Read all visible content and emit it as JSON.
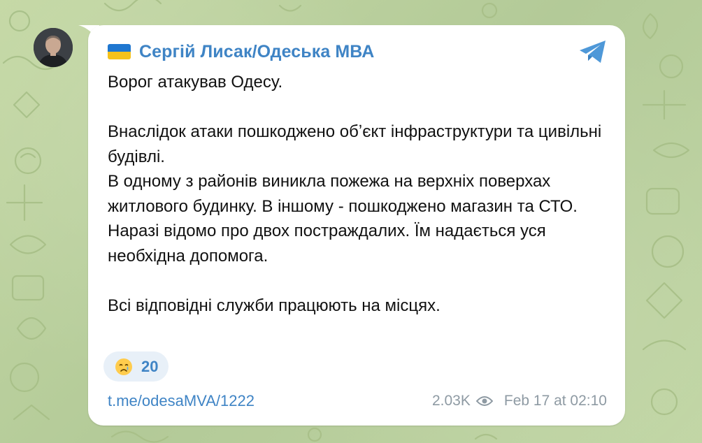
{
  "channel": {
    "name": "Сергій Лисак/Одеська МВА",
    "flag_icon": "ukraine-flag-icon",
    "brand_color": "#3f84c5"
  },
  "message": {
    "text": "Ворог атакував Одесу.\n\nВнаслідок атаки пошкоджено обʼєкт інфраструктури та цивільні будівлі.\nВ одному з районів виникла пожежа на верхніх поверхах житлового будинку. В іншому - пошкоджено магазин та СТО.\nНаразі відомо про двох постраждалих. Їм надається уся необхідна допомога.\n\nВсі відповідні служби працюють на місцях."
  },
  "reaction": {
    "emoji_icon": "crying-face-icon",
    "count": "20"
  },
  "footer": {
    "link": "t.me/odesaMVA/1222",
    "views": "2.03K",
    "views_icon": "eye-icon",
    "timestamp": "Feb 17 at 02:10"
  },
  "icons": {
    "share": "telegram-plane-icon"
  }
}
